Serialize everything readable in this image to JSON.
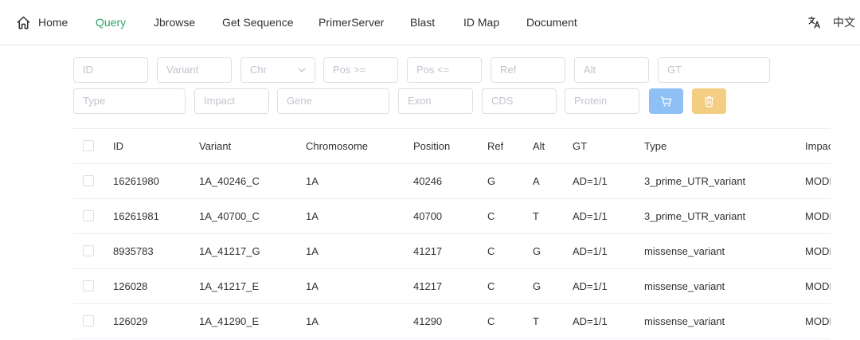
{
  "nav": {
    "home": "Home",
    "query": "Query",
    "jbrowse": "Jbrowse",
    "get_sequence": "Get Sequence",
    "primer_server": "PrimerServer",
    "blast": "Blast",
    "id_map": "ID Map",
    "document": "Document",
    "language": "中文",
    "active_color": "#2fa36b"
  },
  "filters": {
    "id": "ID",
    "variant": "Variant",
    "chr": "Chr",
    "pos_min": "Pos >=",
    "pos_max": "Pos <=",
    "ref": "Ref",
    "alt": "Alt",
    "gt": "GT",
    "type": "Type",
    "impact": "Impact",
    "gene": "Gene",
    "exon": "Exon",
    "cds": "CDS",
    "protein": "Protein",
    "cart_color": "#8fc0f5",
    "delete_color": "#f3cd82"
  },
  "table": {
    "headers": {
      "id": "ID",
      "variant": "Variant",
      "chromosome": "Chromosome",
      "position": "Position",
      "ref": "Ref",
      "alt": "Alt",
      "gt": "GT",
      "type": "Type",
      "impact": "Impac"
    },
    "rows": [
      {
        "id": "16261980",
        "variant": "1A_40246_C",
        "chromosome": "1A",
        "position": "40246",
        "ref": "G",
        "alt": "A",
        "gt": "AD=1/1",
        "type": "3_prime_UTR_variant",
        "impact": "MODI"
      },
      {
        "id": "16261981",
        "variant": "1A_40700_C",
        "chromosome": "1A",
        "position": "40700",
        "ref": "C",
        "alt": "T",
        "gt": "AD=1/1",
        "type": "3_prime_UTR_variant",
        "impact": "MODI"
      },
      {
        "id": "8935783",
        "variant": "1A_41217_G",
        "chromosome": "1A",
        "position": "41217",
        "ref": "C",
        "alt": "G",
        "gt": "AD=1/1",
        "type": "missense_variant",
        "impact": "MODI"
      },
      {
        "id": "126028",
        "variant": "1A_41217_E",
        "chromosome": "1A",
        "position": "41217",
        "ref": "C",
        "alt": "G",
        "gt": "AD=1/1",
        "type": "missense_variant",
        "impact": "MODI"
      },
      {
        "id": "126029",
        "variant": "1A_41290_E",
        "chromosome": "1A",
        "position": "41290",
        "ref": "C",
        "alt": "T",
        "gt": "AD=1/1",
        "type": "missense_variant",
        "impact": "MODI"
      }
    ]
  }
}
